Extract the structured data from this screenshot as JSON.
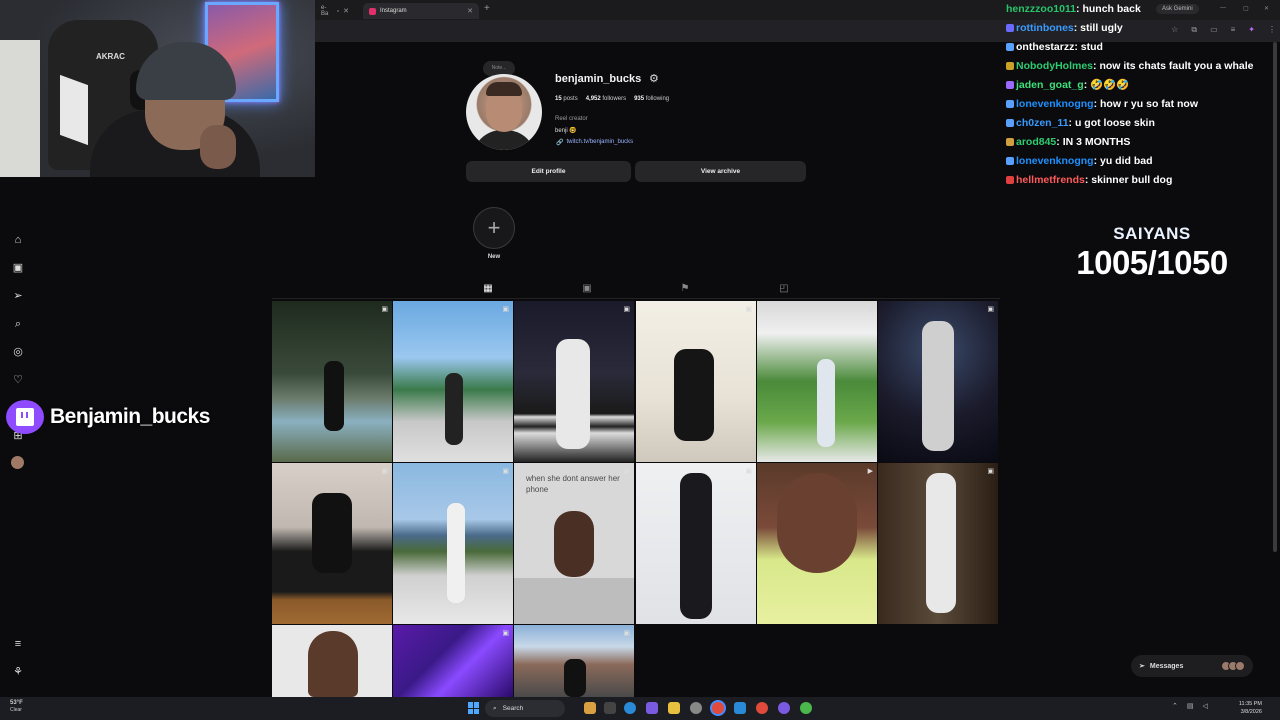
{
  "browser": {
    "tabs": [
      {
        "title": "e-Ba",
        "active": false
      },
      {
        "title": "Instagram",
        "active": true
      }
    ],
    "new_tab_label": "+",
    "close_label": "✕",
    "ask_gemini": "Ask Gemini"
  },
  "webcam": {
    "chair_brand": "AKRAC"
  },
  "profile": {
    "note_label": "Note...",
    "username": "benjamin_bucks",
    "posts": "15",
    "posts_label": "posts",
    "followers": "4,952",
    "followers_label": "followers",
    "following": "935",
    "following_label": "following",
    "category": "Reel creator",
    "bio": "benji 🤓",
    "link": "twitch.tv/benjamin_bucks",
    "edit_profile": "Edit profile",
    "view_archive": "View archive",
    "new_highlight": "New",
    "new_plus": "+"
  },
  "grid": {
    "caption_post_8": "when she dont answer her phone"
  },
  "chat": [
    {
      "user": "henzzzoo1011",
      "color": "#27c46a",
      "badge": "",
      "text": "hunch back"
    },
    {
      "user": "rottinbones",
      "color": "#3a9bff",
      "badge": "#6a6aff",
      "text": "still ugly"
    },
    {
      "user": "onthestarzz",
      "color": "#ffffff",
      "badge": "#5aa0ff",
      "text": "stud"
    },
    {
      "user": "NobodyHolmes",
      "color": "#2ecc71",
      "badge": "#c9a227",
      "text": "now its chats fault you a whale"
    },
    {
      "user": "jaden_goat_g",
      "color": "#3ee07a",
      "badge": "#9a6aff",
      "text": "🤣🤣🤣"
    },
    {
      "user": "lonevenknogng",
      "color": "#1e90ff",
      "badge": "#5aa0ff",
      "text": "how r yu so fat now"
    },
    {
      "user": "ch0zen_11",
      "color": "#3a9bff",
      "badge": "#5aa0ff",
      "text": "u got loose skin"
    },
    {
      "user": "arod845",
      "color": "#2ecc71",
      "badge": "#d0a040",
      "text": "IN 3 MONTHS"
    },
    {
      "user": "lonevenknogng",
      "color": "#1e90ff",
      "badge": "#5aa0ff",
      "text": "yu did bad"
    },
    {
      "user": "hellmetfrends",
      "color": "#ff5a5a",
      "badge": "#e04040",
      "text": "skinner bull dog"
    }
  ],
  "saiyans": {
    "title": "SAIYANS",
    "count": "1005/1050"
  },
  "twitch": {
    "name": "Benjamin_bucks"
  },
  "messages": {
    "label": "Messages"
  },
  "taskbar": {
    "temperature": "53°F",
    "condition": "Clear",
    "search_placeholder": "Search",
    "time": "11:35 PM",
    "date": "3/8/2026"
  },
  "colors": {
    "accent_twitch": "#8e4bff",
    "ig_link": "#9ab4ff"
  },
  "icons": [
    "home-icon",
    "reels-icon",
    "send-icon",
    "search-icon",
    "explore-icon",
    "heart-icon",
    "menu-icon",
    "threads-icon",
    "grid-icon",
    "reels-tab-icon",
    "saved-icon",
    "tagged-icon"
  ]
}
